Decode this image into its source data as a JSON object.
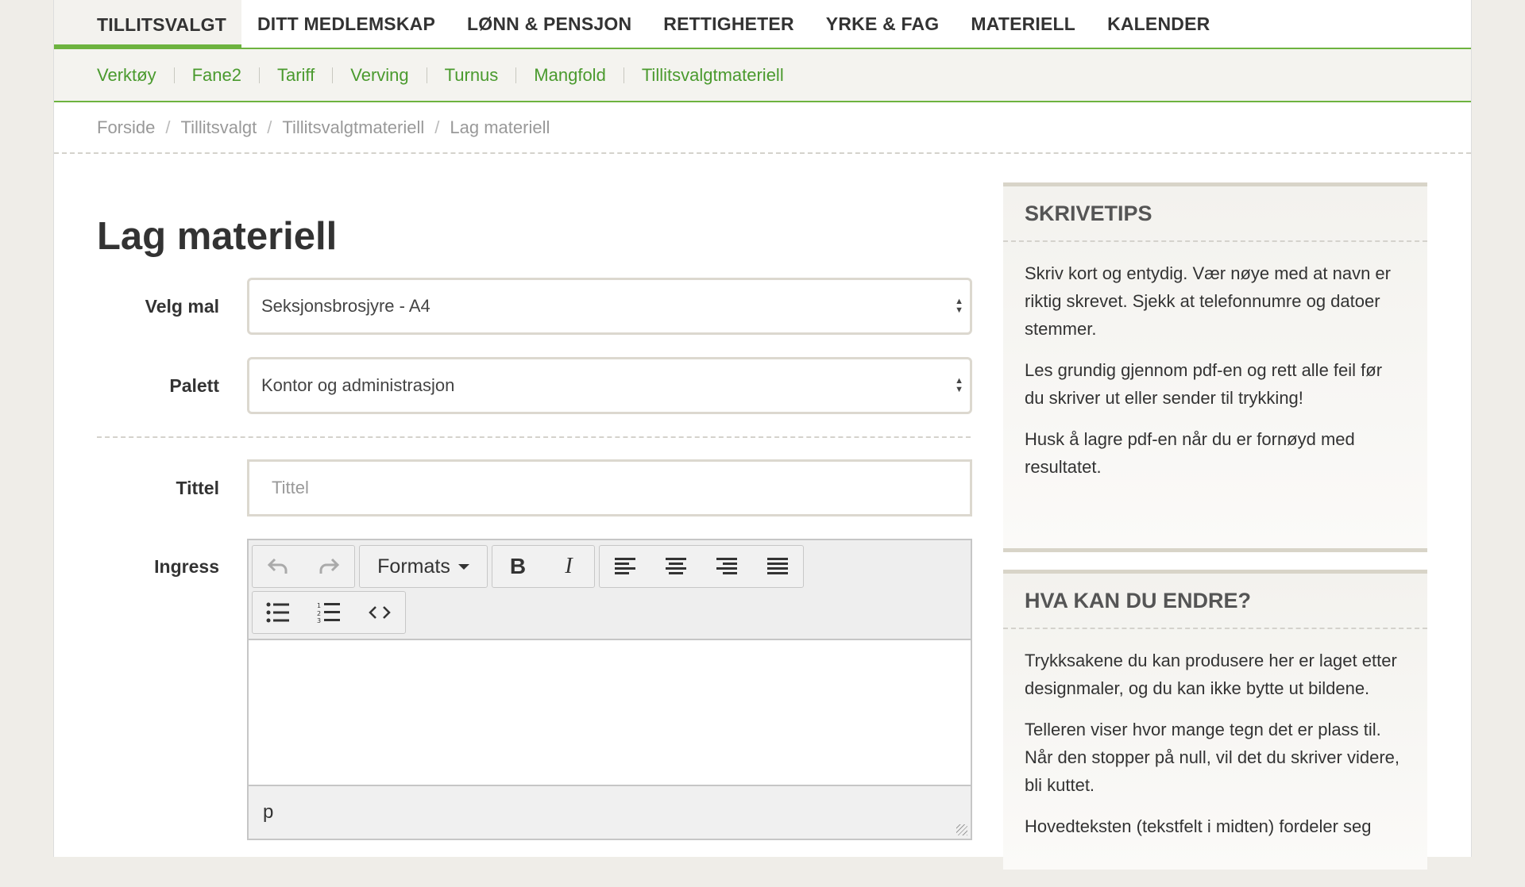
{
  "mainnav": {
    "items": [
      "TILLITSVALGT",
      "DITT MEDLEMSKAP",
      "LØNN & PENSJON",
      "RETTIGHETER",
      "YRKE & FAG",
      "MATERIELL",
      "KALENDER"
    ]
  },
  "subnav": {
    "items": [
      "Verktøy",
      "Fane2",
      "Tariff",
      "Verving",
      "Turnus",
      "Mangfold",
      "Tillitsvalgtmateriell"
    ]
  },
  "breadcrumb": [
    "Forside",
    "Tillitsvalgt",
    "Tillitsvalgtmateriell",
    "Lag materiell"
  ],
  "page_title": "Lag materiell",
  "form": {
    "template_label": "Velg mal",
    "template_value": "Seksjonsbrosjyre - A4",
    "palette_label": "Palett",
    "palette_value": "Kontor og administrasjon",
    "title_label": "Tittel",
    "title_placeholder": "Tittel",
    "ingress_label": "Ingress",
    "editor": {
      "formats_label": "Formats",
      "status_path": "p"
    }
  },
  "sidebar": {
    "tips_title": "SKRIVETIPS",
    "tips": [
      "Skriv kort og entydig. Vær nøye med at navn er riktig skrevet. Sjekk at telefonnumre og datoer stemmer.",
      "Les grundig gjennom pdf-en og rett alle feil før du skriver ut eller sender til trykking!",
      "Husk å lagre pdf-en når du er fornøyd med resultatet."
    ],
    "change_title": "HVA KAN DU ENDRE?",
    "change": [
      "Trykksakene du kan produsere her er laget etter designmaler, og du kan ikke bytte ut bildene.",
      "Telleren viser hvor mange tegn det er plass til. Når den stopper på null, vil det du skriver videre, bli kuttet.",
      "Hovedteksten (tekstfelt i midten) fordeler seg"
    ]
  },
  "colors": {
    "accent": "#6db33f",
    "link": "#4a9a2e"
  }
}
